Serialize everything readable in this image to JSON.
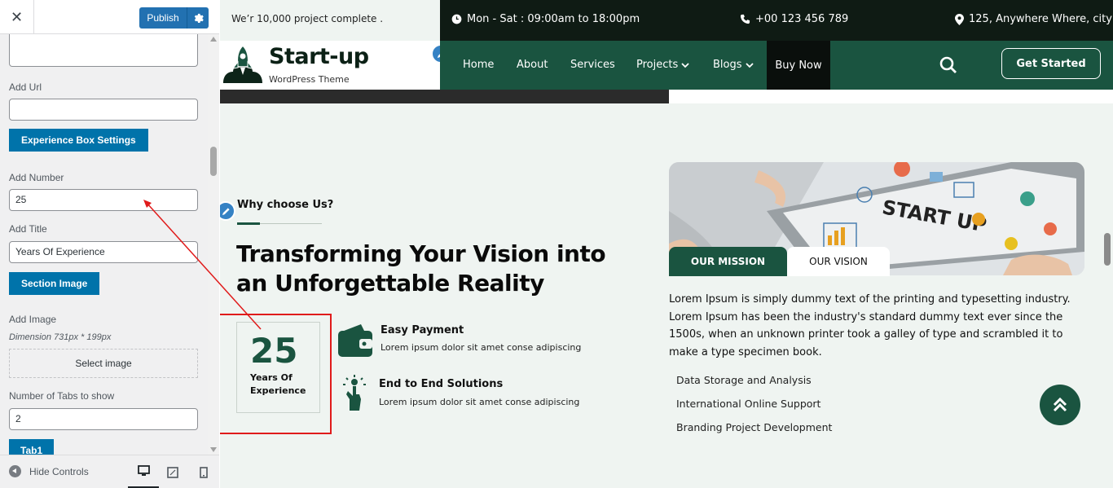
{
  "customizer": {
    "publish_label": "Publish",
    "fields": {
      "add_url_label": "Add Url",
      "add_url_value": "",
      "experience_box_button": "Experience Box Settings",
      "add_number_label": "Add Number",
      "add_number_value": "25",
      "add_title_label": "Add Title",
      "add_title_value": "Years Of Experience",
      "section_image_button": "Section Image",
      "add_image_label": "Add Image",
      "dimension_note": "Dimension 731px * 199px",
      "select_image_label": "Select image",
      "tabs_count_label": "Number of Tabs to show",
      "tabs_count_value": "2",
      "tab1_button": "Tab1"
    },
    "footer": {
      "hide_controls_label": "Hide Controls",
      "devices": [
        "desktop-icon",
        "tablet-icon",
        "mobile-icon"
      ]
    }
  },
  "site": {
    "topbar": {
      "tagline": "We’r 10,000 project complete .",
      "hours": "Mon - Sat : 09:00am to 18:00pm",
      "phone": "+00 123 456 789",
      "address": "125, Anywhere Where, city"
    },
    "brand": {
      "title": "Start-up",
      "subtitle": "WordPress Theme"
    },
    "nav": {
      "items": [
        "Home",
        "About",
        "Services",
        "Projects",
        "Blogs"
      ],
      "buy_now": "Buy Now",
      "get_started": "Get Started"
    },
    "why": {
      "label": "Why choose Us?",
      "heading": "Transforming Your Vision into an Unforgettable Reality",
      "experience_number": "25",
      "experience_title": "Years Of Experience",
      "features": [
        {
          "title": "Easy Payment",
          "desc": "Lorem ipsum dolor sit amet conse adipiscing"
        },
        {
          "title": "End to End Solutions",
          "desc": "Lorem ipsum dolor sit amet conse adipiscing"
        }
      ]
    },
    "mission": {
      "image_text": "START UP",
      "tabs": [
        "OUR MISSION",
        "OUR VISION"
      ],
      "text": "Lorem Ipsum is simply dummy text of the printing and typesetting industry. Lorem Ipsum has been the industry's standard dummy text ever since the 1500s, when an unknown printer took a galley of type and scrambled it to make a type specimen book.",
      "bullets": [
        "Data Storage and Analysis",
        "International Online Support",
        "Branding Project Development"
      ]
    },
    "colors": {
      "brand_green": "#1a5440",
      "dark": "#0f1b14",
      "annotation_red": "#e01b1b"
    }
  }
}
